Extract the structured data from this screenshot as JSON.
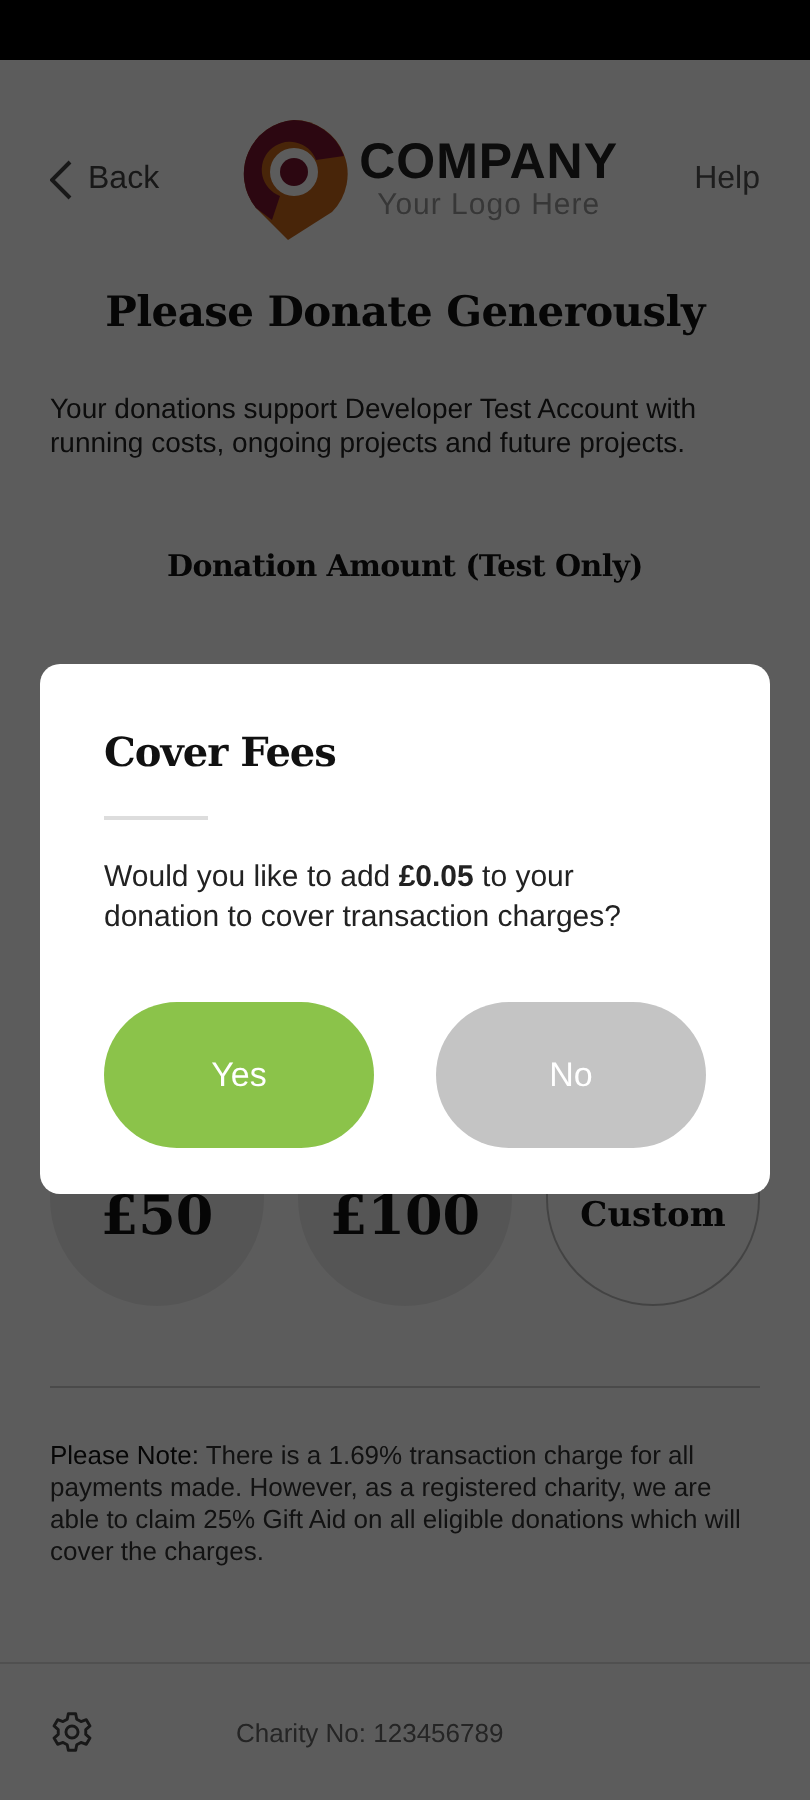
{
  "header": {
    "back": "Back",
    "logo_name": "COMPANY",
    "logo_tagline": "Your Logo Here",
    "help": "Help"
  },
  "title": "Please Donate Generously",
  "intro": "Your donations support Developer Test Account with running costs, ongoing projects and future projects.",
  "amount_heading": "Donation Amount (Test Only)",
  "amounts": [
    {
      "label": "£50",
      "kind": "preset"
    },
    {
      "label": "£100",
      "kind": "preset"
    },
    {
      "label": "Custom",
      "kind": "custom"
    }
  ],
  "note": "**Please Note:** There is a 1.69% transaction charge for all payments made. However, as a registered charity, we are able to claim 25% Gift Aid on all eligible donations which will cover the charges.",
  "footer": {
    "charity_no": "Charity No: 123456789"
  },
  "dialog": {
    "title": "Cover Fees",
    "message": "Would you like to add **£0.05** to your donation to cover transaction charges?",
    "buttons": [
      {
        "label": "Yes",
        "kind": "primary"
      },
      {
        "label": "No",
        "kind": "secondary"
      }
    ]
  }
}
